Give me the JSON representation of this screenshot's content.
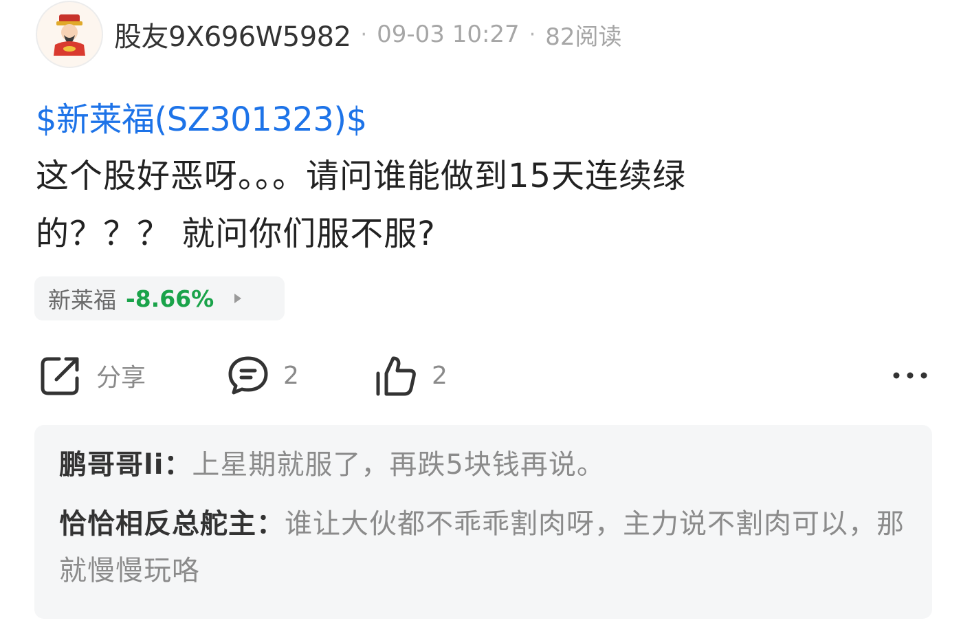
{
  "post": {
    "username": "股友9X696W5982",
    "separator": "·",
    "date_time": "09-03 10:27",
    "read_count": "82阅读",
    "stock_link": "$新莱福(SZ301323)$",
    "content_lines": [
      "这个股好恶呀。。。请问谁能做到15天连续绿",
      "的？？？ 就问你们服不服?"
    ],
    "stock_chip": {
      "name": "新莱福",
      "change": "-8.66%",
      "change_color": "#1aa34a"
    },
    "link_color": "#1d73e8"
  },
  "actions": {
    "share_label": "分享",
    "share_icon": "share-icon",
    "comment_count": "2",
    "comment_icon": "comment-bubble-icon",
    "like_count": "2",
    "like_icon": "thumbs-up-icon",
    "more_icon": "more-dots-icon"
  },
  "comments": [
    {
      "author": "鹏哥哥li：",
      "text": "上星期就服了，再跌5块钱再说。"
    },
    {
      "author": "恰恰相反总舵主：",
      "text": "谁让大伙都不乖乖割肉呀，主力说不割肉可以，那就慢慢玩咯"
    }
  ]
}
